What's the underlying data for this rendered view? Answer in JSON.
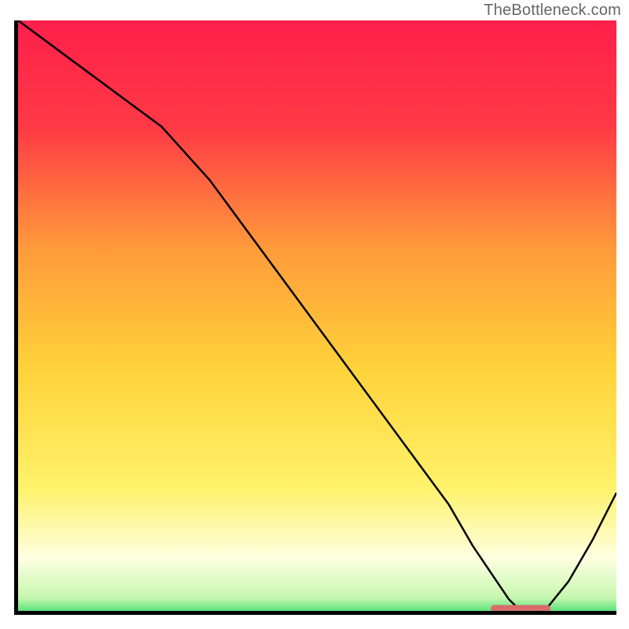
{
  "watermark": "TheBottleneck.com",
  "colors": {
    "top": "#ff1f4b",
    "upper_mid": "#ff7a3a",
    "mid": "#ffd23a",
    "lower_mid": "#fff26a",
    "pale": "#fdffe0",
    "green": "#1bd65a",
    "line": "#000000",
    "marker": "#d86b6b"
  },
  "chart_data": {
    "type": "line",
    "title": "",
    "xlabel": "",
    "ylabel": "",
    "xlim": [
      0,
      100
    ],
    "ylim": [
      0,
      100
    ],
    "x": [
      0,
      8,
      16,
      24,
      32,
      40,
      48,
      56,
      64,
      72,
      76,
      80,
      82,
      84,
      88,
      92,
      96,
      100
    ],
    "values": [
      100,
      94,
      88,
      82,
      73,
      62,
      51,
      40,
      29,
      18,
      11,
      5,
      2,
      0,
      0,
      5,
      12,
      20
    ],
    "marker": {
      "x_start": 79,
      "x_end": 89,
      "y": 0
    },
    "gradient_stops": [
      {
        "offset": 0.0,
        "color": "#ff1f4b"
      },
      {
        "offset": 0.18,
        "color": "#ff3a45"
      },
      {
        "offset": 0.38,
        "color": "#ff9a3a"
      },
      {
        "offset": 0.58,
        "color": "#ffd23a"
      },
      {
        "offset": 0.78,
        "color": "#fff26a"
      },
      {
        "offset": 0.9,
        "color": "#fdffe0"
      },
      {
        "offset": 0.965,
        "color": "#c6f7b0"
      },
      {
        "offset": 1.0,
        "color": "#1bd65a"
      }
    ]
  }
}
